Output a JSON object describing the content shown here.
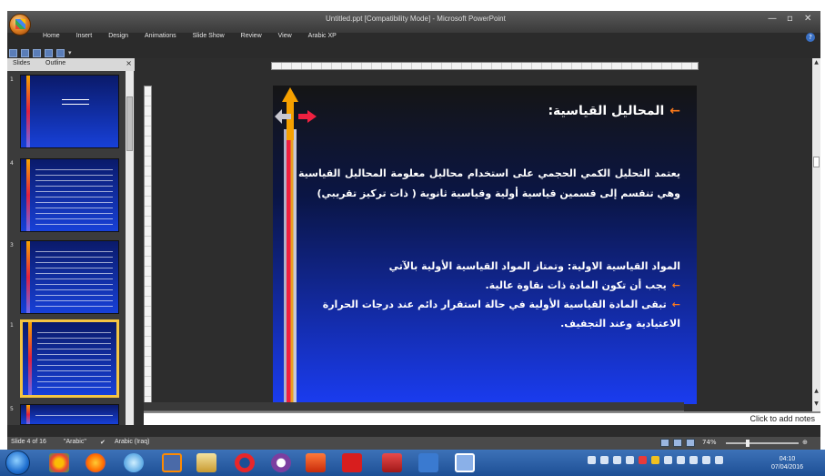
{
  "window": {
    "title": "Untitled.ppt [Compatibility Mode] - Microsoft PowerPoint",
    "minimize": "—",
    "maximize": "▫",
    "close": "✕"
  },
  "ribbon": {
    "tabs": [
      "Home",
      "Insert",
      "Design",
      "Animations",
      "Slide Show",
      "Review",
      "View",
      "Arabic XP"
    ]
  },
  "slides_pane": {
    "tab_slides": "Slides",
    "tab_outline": "Outline",
    "close": "×",
    "thumbnails": [
      {
        "number": "1",
        "selected": false
      },
      {
        "number": "4",
        "selected": false
      },
      {
        "number": "3",
        "selected": false
      },
      {
        "number": "1",
        "selected": true
      },
      {
        "number": "5",
        "selected": false
      }
    ]
  },
  "slide": {
    "title": "المحاليل القياسية:",
    "paragraph1": "يعتمد التحليل الكمي الحجمي على استخدام محاليل معلومة المحاليل القياسية وهي تنقسم إلى قسمين قياسية أولية وقياسية ثانوية ( ذات تركيز تقريبي)",
    "paragraph2_intro": "المواد القياسية الاولية: وتمتاز المواد القياسية الأولية بالآتي",
    "bullets": [
      "يجب أن تكون المادة ذات نقاوة عالية.",
      "تبقى المادة القياسية الأولية في حالة استقرار دائم عند درجات الحرارة الاعتيادية وعند التجفيف."
    ],
    "arrow_glyph": "←"
  },
  "notes": {
    "placeholder": "Click to add notes"
  },
  "statusbar": {
    "slide_info": "Slide 4 of 16",
    "theme": "\"Arabic\"",
    "language": "Arabic (Iraq)",
    "zoom": "74%"
  },
  "taskbar": {
    "time": "04:10",
    "date": "07/04/2016"
  },
  "colors": {
    "accent_arrow": "#ff7a1a",
    "slide_bottom": "#1a3cf0",
    "taskbar": "#2a60a8"
  }
}
